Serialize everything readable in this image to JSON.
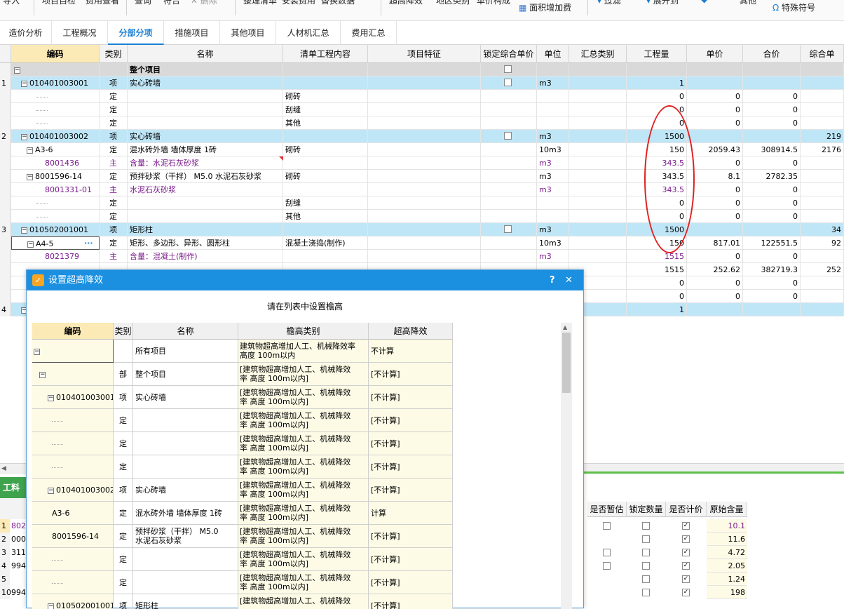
{
  "toolbar": {
    "items": [
      "导入",
      "项目自检",
      "费用查看",
      "查询",
      "符合",
      "删除",
      "整理清单",
      "安装费用",
      "替换数据",
      "超高降效",
      "地区类别",
      "单价构成",
      "面积增加费",
      "过滤",
      "展开到",
      "其他",
      "特殊符号"
    ]
  },
  "tabs": [
    "造价分析",
    "工程概况",
    "分部分项",
    "措施项目",
    "其他项目",
    "人材机汇总",
    "费用汇总"
  ],
  "active_tab": "分部分项",
  "grid": {
    "headers": [
      "编码",
      "类别",
      "名称",
      "清单工程内容",
      "项目特征",
      "锁定综合单价",
      "单位",
      "汇总类别",
      "工程量",
      "单价",
      "合价",
      "综合单"
    ],
    "rows": [
      {
        "rn": "",
        "code": "",
        "type": "",
        "name": "整个项目",
        "content": "",
        "unit": "",
        "qty": "",
        "price": "",
        "total": "",
        "comp": "",
        "style": "top"
      },
      {
        "rn": "1",
        "code": "010401003001",
        "type": "项",
        "name": "实心砖墙",
        "content": "",
        "unit": "m3",
        "qty": "1",
        "price": "",
        "total": "",
        "comp": "",
        "style": "band"
      },
      {
        "rn": "",
        "code": "",
        "type": "定",
        "name": "",
        "content": "砌砖",
        "unit": "",
        "qty": "0",
        "price": "0",
        "total": "0",
        "comp": "",
        "style": ""
      },
      {
        "rn": "",
        "code": "",
        "type": "定",
        "name": "",
        "content": "刮缝",
        "unit": "",
        "qty": "0",
        "price": "0",
        "total": "0",
        "comp": "",
        "style": ""
      },
      {
        "rn": "",
        "code": "",
        "type": "定",
        "name": "",
        "content": "其他",
        "unit": "",
        "qty": "0",
        "price": "0",
        "total": "0",
        "comp": "",
        "style": ""
      },
      {
        "rn": "2",
        "code": "010401003002",
        "type": "项",
        "name": "实心砖墙",
        "content": "",
        "unit": "m3",
        "qty": "1500",
        "price": "",
        "total": "",
        "comp": "219",
        "style": "band"
      },
      {
        "rn": "",
        "code": "A3-6",
        "type": "定",
        "name": "混水砖外墙 墙体厚度 1砖",
        "content": "砌砖",
        "unit": "10m3",
        "qty": "150",
        "price": "2059.43",
        "total": "308914.5",
        "comp": "2176",
        "style": ""
      },
      {
        "rn": "",
        "code": "8001436",
        "type": "主",
        "name": "含量：水泥石灰砂浆",
        "content": "",
        "unit": "m3",
        "qty": "343.5",
        "price": "0",
        "total": "0",
        "comp": "",
        "style": "purple"
      },
      {
        "rn": "",
        "code": "8001596-14",
        "type": "定",
        "name": "预拌砂浆（干拌） M5.0 水泥石灰砂浆",
        "content": "砌砖",
        "unit": "m3",
        "qty": "343.5",
        "price": "8.1",
        "total": "2782.35",
        "comp": "",
        "style": ""
      },
      {
        "rn": "",
        "code": "8001331-01",
        "type": "主",
        "name": "水泥石灰砂浆",
        "content": "",
        "unit": "m3",
        "qty": "343.5",
        "price": "0",
        "total": "0",
        "comp": "",
        "style": "purple"
      },
      {
        "rn": "",
        "code": "",
        "type": "定",
        "name": "",
        "content": "刮缝",
        "unit": "",
        "qty": "0",
        "price": "0",
        "total": "0",
        "comp": "",
        "style": ""
      },
      {
        "rn": "",
        "code": "",
        "type": "定",
        "name": "",
        "content": "其他",
        "unit": "",
        "qty": "0",
        "price": "0",
        "total": "0",
        "comp": "",
        "style": ""
      },
      {
        "rn": "3",
        "code": "010502001001",
        "type": "项",
        "name": "矩形柱",
        "content": "",
        "unit": "m3",
        "qty": "1500",
        "price": "",
        "total": "",
        "comp": "34",
        "style": "band"
      },
      {
        "rn": "",
        "code": "A4-5",
        "type": "定",
        "name": "矩形、多边形、异形、圆形柱",
        "content": "混凝土浇捣(制作)",
        "unit": "10m3",
        "qty": "150",
        "price": "817.01",
        "total": "122551.5",
        "comp": "92",
        "style": ""
      },
      {
        "rn": "",
        "code": "8021379",
        "type": "主",
        "name": "含量：混凝土(制作)",
        "content": "",
        "unit": "m3",
        "qty": "1515",
        "price": "0",
        "total": "0",
        "comp": "",
        "style": "purple"
      },
      {
        "rn": "",
        "code": "",
        "type": "",
        "name": "",
        "content": "",
        "unit": "",
        "qty": "1515",
        "price": "252.62",
        "total": "382719.3",
        "comp": "252",
        "style": ""
      },
      {
        "rn": "",
        "code": "",
        "type": "",
        "name": "",
        "content": "",
        "unit": "",
        "qty": "0",
        "price": "0",
        "total": "0",
        "comp": "",
        "style": ""
      },
      {
        "rn": "",
        "code": "",
        "type": "",
        "name": "",
        "content": "",
        "unit": "",
        "qty": "0",
        "price": "0",
        "total": "0",
        "comp": "",
        "style": ""
      },
      {
        "rn": "4",
        "code": "",
        "type": "",
        "name": "",
        "content": "",
        "unit": "",
        "qty": "1",
        "price": "",
        "total": "",
        "comp": "",
        "style": "band"
      }
    ]
  },
  "bottom": {
    "panel_title": "工料",
    "headers": [
      "是否暂估",
      "锁定数量",
      "是否计价",
      "原始含量"
    ],
    "rownums": [
      "1",
      "2",
      "3",
      "4",
      "5",
      "10"
    ],
    "codes": [
      "802",
      "000",
      "311",
      "994",
      "",
      "994"
    ],
    "values": [
      "10.1",
      "11.6",
      "4.72",
      "2.05",
      "1.24",
      "198"
    ]
  },
  "dialog": {
    "title": "设置超高降效",
    "help": "?",
    "close": "✕",
    "instruction": "请在列表中设置檐高",
    "headers": [
      "编码",
      "类别",
      "名称",
      "檐高类别",
      "超高降效"
    ],
    "rows": [
      {
        "code": "",
        "type": "",
        "name": "所有项目",
        "cat1": "建筑物超高增加人工、机械降效率",
        "cat2": "高度 100m以内",
        "eff": "不计算"
      },
      {
        "code": "",
        "type": "部",
        "name": "整个项目",
        "cat1": "[建筑物超高增加人工、机械降效",
        "cat2": "率 高度 100m以内]",
        "eff": "[不计算]"
      },
      {
        "code": "010401003001",
        "type": "项",
        "name": "实心砖墙",
        "cat1": "[建筑物超高增加人工、机械降效",
        "cat2": "率 高度 100m以内]",
        "eff": "[不计算]"
      },
      {
        "code": "",
        "type": "定",
        "name": "",
        "cat1": "[建筑物超高增加人工、机械降效",
        "cat2": "率 高度 100m以内]",
        "eff": "[不计算]"
      },
      {
        "code": "",
        "type": "定",
        "name": "",
        "cat1": "[建筑物超高增加人工、机械降效",
        "cat2": "率 高度 100m以内]",
        "eff": "[不计算]"
      },
      {
        "code": "",
        "type": "定",
        "name": "",
        "cat1": "[建筑物超高增加人工、机械降效",
        "cat2": "率 高度 100m以内]",
        "eff": "[不计算]"
      },
      {
        "code": "010401003002",
        "type": "项",
        "name": "实心砖墙",
        "cat1": "[建筑物超高增加人工、机械降效",
        "cat2": "率 高度 100m以内]",
        "eff": "[不计算]"
      },
      {
        "code": "A3-6",
        "type": "定",
        "name": "混水砖外墙 墙体厚度 1砖",
        "cat1": "[建筑物超高增加人工、机械降效",
        "cat2": "率 高度 100m以内]",
        "eff": "计算"
      },
      {
        "code": "8001596-14",
        "type": "定",
        "name": "预拌砂浆（干拌） M5.0",
        "name2": "水泥石灰砂浆",
        "cat1": "[建筑物超高增加人工、机械降效",
        "cat2": "率 高度 100m以内]",
        "eff": "[不计算]"
      },
      {
        "code": "",
        "type": "定",
        "name": "",
        "cat1": "[建筑物超高增加人工、机械降效",
        "cat2": "率 高度 100m以内]",
        "eff": "[不计算]"
      },
      {
        "code": "",
        "type": "定",
        "name": "",
        "cat1": "[建筑物超高增加人工、机械降效",
        "cat2": "率 高度 100m以内]",
        "eff": "[不计算]"
      },
      {
        "code": "010502001001",
        "type": "项",
        "name": "矩形柱",
        "cat1": "[建筑物超高增加人工、机械降效",
        "cat2": "",
        "eff": "[不计算]"
      }
    ]
  }
}
